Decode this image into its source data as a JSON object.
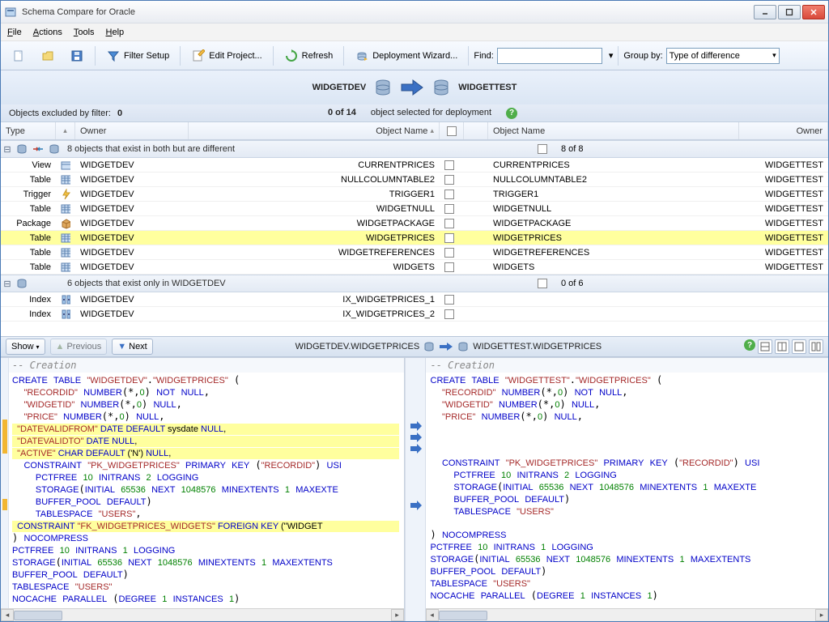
{
  "title": "Schema Compare for Oracle",
  "menu": {
    "file": "File",
    "actions": "Actions",
    "tools": "Tools",
    "help": "Help"
  },
  "toolbar": {
    "filter_setup": "Filter Setup",
    "edit_project": "Edit Project...",
    "refresh": "Refresh",
    "deployment_wizard": "Deployment Wizard...",
    "find": "Find:",
    "group_by": "Group by:",
    "group_by_value": "Type of difference"
  },
  "schemas": {
    "left": "WIDGETDEV",
    "right": "WIDGETTEST"
  },
  "filter_line": {
    "excluded_label": "Objects excluded by filter:",
    "excluded_count": "0",
    "selection": "0 of 14",
    "selection_label": "object selected for deployment"
  },
  "grid": {
    "headers": {
      "type": "Type",
      "owner": "Owner",
      "obj_left": "Object Name",
      "obj_right": "Object Name",
      "owner_right": "Owner"
    },
    "group1": {
      "text": "8 objects that exist in both but are different",
      "count": "8 of 8"
    },
    "group2": {
      "text": "6 objects that exist only in WIDGETDEV",
      "count": "0 of 6"
    },
    "rows": [
      {
        "type": "View",
        "owner": "WIDGETDEV",
        "left": "CURRENTPRICES",
        "right": "CURRENTPRICES",
        "owner_r": "WIDGETTEST",
        "sel": false
      },
      {
        "type": "Table",
        "owner": "WIDGETDEV",
        "left": "NULLCOLUMNTABLE2",
        "right": "NULLCOLUMNTABLE2",
        "owner_r": "WIDGETTEST",
        "sel": false
      },
      {
        "type": "Trigger",
        "owner": "WIDGETDEV",
        "left": "TRIGGER1",
        "right": "TRIGGER1",
        "owner_r": "WIDGETTEST",
        "sel": false
      },
      {
        "type": "Table",
        "owner": "WIDGETDEV",
        "left": "WIDGETNULL",
        "right": "WIDGETNULL",
        "owner_r": "WIDGETTEST",
        "sel": false
      },
      {
        "type": "Package",
        "owner": "WIDGETDEV",
        "left": "WIDGETPACKAGE",
        "right": "WIDGETPACKAGE",
        "owner_r": "WIDGETTEST",
        "sel": false
      },
      {
        "type": "Table",
        "owner": "WIDGETDEV",
        "left": "WIDGETPRICES",
        "right": "WIDGETPRICES",
        "owner_r": "WIDGETTEST",
        "sel": true
      },
      {
        "type": "Table",
        "owner": "WIDGETDEV",
        "left": "WIDGETREFERENCES",
        "right": "WIDGETREFERENCES",
        "owner_r": "WIDGETTEST",
        "sel": false
      },
      {
        "type": "Table",
        "owner": "WIDGETDEV",
        "left": "WIDGETS",
        "right": "WIDGETS",
        "owner_r": "WIDGETTEST",
        "sel": false
      }
    ],
    "rows2": [
      {
        "type": "Index",
        "owner": "WIDGETDEV",
        "left": "IX_WIDGETPRICES_1",
        "right": "",
        "owner_r": ""
      },
      {
        "type": "Index",
        "owner": "WIDGETDEV",
        "left": "IX_WIDGETPRICES_2",
        "right": "",
        "owner_r": ""
      }
    ]
  },
  "sqlbar": {
    "show": "Show",
    "prev": "Previous",
    "next": "Next",
    "left_title": "WIDGETDEV.WIDGETPRICES",
    "right_title": "WIDGETTEST.WIDGETPRICES"
  },
  "sql": {
    "creation": "-- Creation",
    "left": "CREATE TABLE \"WIDGETDEV\".\"WIDGETPRICES\" (\n  \"RECORDID\" NUMBER(*,0) NOT NULL,\n  \"WIDGETID\" NUMBER(*,0) NULL,\n  \"PRICE\" NUMBER(*,0) NULL,\n  \"DATEVALIDFROM\" DATE DEFAULT sysdate NULL,\n  \"DATEVALIDTO\" DATE NULL,\n  \"ACTIVE\" CHAR DEFAULT ('N') NULL,\n  CONSTRAINT \"PK_WIDGETPRICES\" PRIMARY KEY (\"RECORDID\") USI\n    PCTFREE 10 INITRANS 2 LOGGING\n    STORAGE(INITIAL 65536 NEXT 1048576 MINEXTENTS 1 MAXEXTE\n    BUFFER_POOL DEFAULT)\n    TABLESPACE \"USERS\",\n  CONSTRAINT \"FK_WIDGETPRICES_WIDGETS\" FOREIGN KEY (\"WIDGET\n) NOCOMPRESS\nPCTFREE 10 INITRANS 1 LOGGING\nSTORAGE(INITIAL 65536 NEXT 1048576 MINEXTENTS 1 MAXEXTENTS\nBUFFER_POOL DEFAULT)\nTABLESPACE \"USERS\"\nNOCACHE PARALLEL (DEGREE 1 INSTANCES 1)",
    "right": "CREATE TABLE \"WIDGETTEST\".\"WIDGETPRICES\" (\n  \"RECORDID\" NUMBER(*,0) NOT NULL,\n  \"WIDGETID\" NUMBER(*,0) NULL,\n  \"PRICE\" NUMBER(*,0) NULL,\n\n\n\n  CONSTRAINT \"PK_WIDGETPRICES\" PRIMARY KEY (\"RECORDID\") USI\n    PCTFREE 10 INITRANS 2 LOGGING\n    STORAGE(INITIAL 65536 NEXT 1048576 MINEXTENTS 1 MAXEXTE\n    BUFFER_POOL DEFAULT)\n    TABLESPACE \"USERS\"\n\n) NOCOMPRESS\nPCTFREE 10 INITRANS 1 LOGGING\nSTORAGE(INITIAL 65536 NEXT 1048576 MINEXTENTS 1 MAXEXTENTS\nBUFFER_POOL DEFAULT)\nTABLESPACE \"USERS\"\nNOCACHE PARALLEL (DEGREE 1 INSTANCES 1)"
  }
}
